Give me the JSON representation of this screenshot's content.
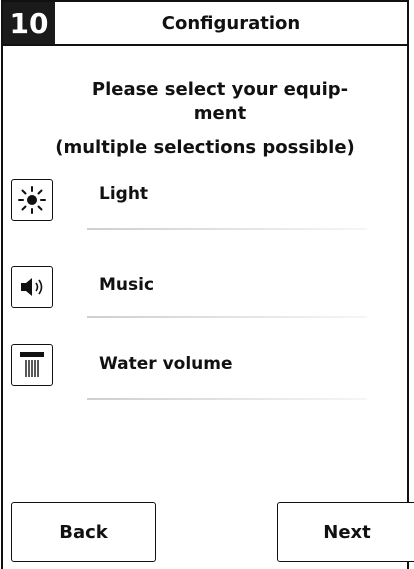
{
  "header": {
    "step": "10",
    "title": "Configuration"
  },
  "prompt": {
    "line1": "Please select your equip-",
    "line2": "ment",
    "line3": "(multiple selections possible)"
  },
  "items": [
    {
      "label": "Light",
      "icon": "sun-icon"
    },
    {
      "label": "Music",
      "icon": "speaker-icon"
    },
    {
      "label": "Water volume",
      "icon": "shower-icon"
    }
  ],
  "buttons": {
    "back": "Back",
    "next": "Next"
  },
  "colors": {
    "frame": "#111111",
    "step_bg": "#1a1a1a",
    "divider": "#d6d6d6"
  }
}
